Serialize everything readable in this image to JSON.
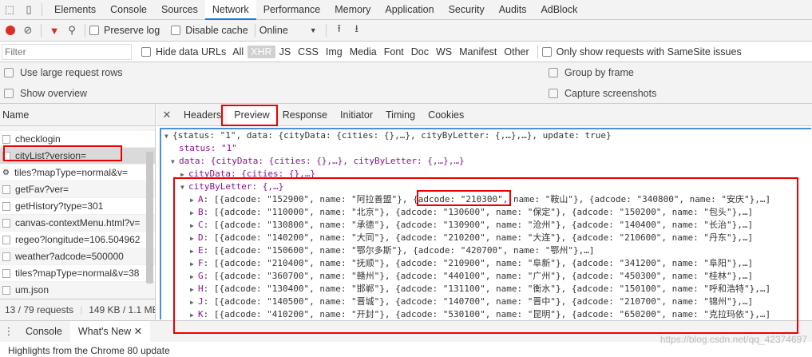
{
  "top_tabs": [
    "Elements",
    "Console",
    "Sources",
    "Network",
    "Performance",
    "Memory",
    "Application",
    "Security",
    "Audits",
    "AdBlock"
  ],
  "active_top_tab": "Network",
  "toolbar": {
    "preserve_log": "Preserve log",
    "disable_cache": "Disable cache",
    "throttle": "Online"
  },
  "filter": {
    "placeholder": "Filter",
    "hide_data_urls": "Hide data URLs",
    "types": [
      "All",
      "XHR",
      "JS",
      "CSS",
      "Img",
      "Media",
      "Font",
      "Doc",
      "WS",
      "Manifest",
      "Other"
    ],
    "selected_type": "XHR",
    "samesite": "Only show requests with SameSite issues"
  },
  "options": {
    "large_rows": "Use large request rows",
    "group_by_frame": "Group by frame",
    "show_overview": "Show overview",
    "capture_screenshots": "Capture screenshots"
  },
  "requests": {
    "header": "Name",
    "items": [
      "checklogin",
      "cityList?version=",
      "tiles?mapType=normal&v=",
      "getFav?ver=",
      "getHistory?type=301",
      "canvas-contextMenu.html?v=",
      "regeo?longitude=106.504962",
      "weather?adcode=500000",
      "tiles?mapType=normal&v=38",
      "um.json"
    ],
    "status": "13 / 79 requests",
    "size": "149 KB / 1.1 ME"
  },
  "detail_tabs": [
    "Headers",
    "Preview",
    "Response",
    "Initiator",
    "Timing",
    "Cookies"
  ],
  "active_detail_tab": "Preview",
  "preview": {
    "root": "{status: \"1\", data: {cityData: {cities: {},…}, cityByLetter: {,…},…}, update: true}",
    "status_line": "status: \"1\"",
    "data_line": "data: {cityData: {cities: {},…}, cityByLetter: {,…},…}",
    "citydata_line": "cityData: {cities: {},…}",
    "citybyletter_line": "cityByLetter: {,…}",
    "letters": [
      {
        "k": "A",
        "v": "[{adcode: \"152900\", name: \"阿拉善盟\"}, {adcode: \"210300\", name: \"鞍山\"}, {adcode: \"340800\", name: \"安庆\"},…]"
      },
      {
        "k": "B",
        "v": "[{adcode: \"110000\", name: \"北京\"}, {adcode: \"130600\", name: \"保定\"}, {adcode: \"150200\", name: \"包头\"},…]"
      },
      {
        "k": "C",
        "v": "[{adcode: \"130800\", name: \"承德\"}, {adcode: \"130900\", name: \"沧州\"}, {adcode: \"140400\", name: \"长治\"},…]"
      },
      {
        "k": "D",
        "v": "[{adcode: \"140200\", name: \"大同\"}, {adcode: \"210200\", name: \"大连\"}, {adcode: \"210600\", name: \"丹东\"},…]"
      },
      {
        "k": "E",
        "v": "[{adcode: \"150600\", name: \"鄂尔多斯\"}, {adcode: \"420700\", name: \"鄂州\"},…]"
      },
      {
        "k": "F",
        "v": "[{adcode: \"210400\", name: \"抚顺\"}, {adcode: \"210900\", name: \"阜新\"}, {adcode: \"341200\", name: \"阜阳\"},…]"
      },
      {
        "k": "G",
        "v": "[{adcode: \"360700\", name: \"赣州\"}, {adcode: \"440100\", name: \"广州\"}, {adcode: \"450300\", name: \"桂林\"},…]"
      },
      {
        "k": "H",
        "v": "[{adcode: \"130400\", name: \"邯郸\"}, {adcode: \"131100\", name: \"衡水\"}, {adcode: \"150100\", name: \"呼和浩特\"},…]"
      },
      {
        "k": "J",
        "v": "[{adcode: \"140500\", name: \"晋城\"}, {adcode: \"140700\", name: \"晋中\"}, {adcode: \"210700\", name: \"锦州\"},…]"
      },
      {
        "k": "K",
        "v": "[{adcode: \"410200\", name: \"开封\"}, {adcode: \"530100\", name: \"昆明\"}, {adcode: \"650200\", name: \"克拉玛依\"},…]"
      }
    ]
  },
  "drawer_tabs": [
    "Console",
    "What's New"
  ],
  "active_drawer_tab": "What's New",
  "drawer_text": "Highlights from the Chrome 80 update",
  "watermark": "https://blog.csdn.net/qq_42374697"
}
